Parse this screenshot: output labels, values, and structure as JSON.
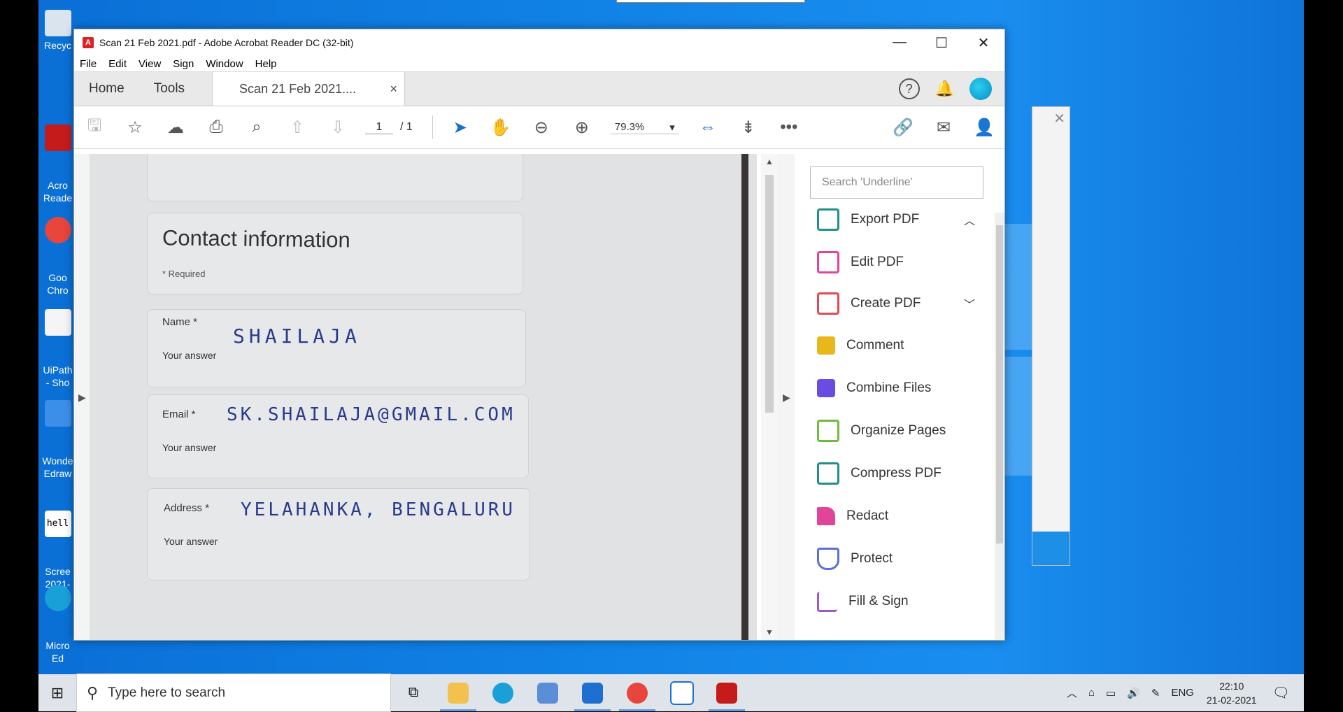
{
  "desktop": {
    "icons": [
      {
        "label": "Recyc",
        "color": "#d9e4ee"
      },
      {
        "label": "Acro\nReade",
        "color": "#c61b1b"
      },
      {
        "label": "Goo\nChro",
        "color": "#e8453c"
      },
      {
        "label": "UiPath\n- Sho",
        "color": "#f5f5f5"
      },
      {
        "label": "Wonde\nEdraw",
        "color": "#3b8fe8"
      },
      {
        "label": "Scree\n2021-",
        "color": "#ffffff"
      },
      {
        "label": "Micro\nEd",
        "color": "#1aa0d8"
      }
    ],
    "screen_text_icon": "hell"
  },
  "window": {
    "title": "Scan 21 Feb 2021.pdf - Adobe Acrobat Reader DC (32-bit)",
    "min": "—",
    "max": "☐",
    "close": "✕"
  },
  "menu": [
    "File",
    "Edit",
    "View",
    "Sign",
    "Window",
    "Help"
  ],
  "tabs": {
    "home": "Home",
    "tools": "Tools",
    "doc": "Scan 21 Feb 2021....",
    "doc_close": "×",
    "help": "?"
  },
  "toolbar": {
    "page_current": "1",
    "page_total": "/ 1",
    "zoom": "79.3%"
  },
  "form": {
    "heading": "Contact information",
    "required": "* Required",
    "name_label": "Name *",
    "name_answer_label": "Your answer",
    "name_value": "SHAILAJA",
    "email_label": "Email *",
    "email_answer_label": "Your answer",
    "email_value": "SK.SHAILAJA@GMAIL.COM",
    "address_label": "Address *",
    "address_answer_label": "Your answer",
    "address_value": "YELAHANKA, BENGALURU"
  },
  "panel": {
    "search_placeholder": "Search 'Underline'",
    "tools": [
      {
        "label": "Export PDF",
        "color": "#1f8f8c",
        "chevron": "︿"
      },
      {
        "label": "Edit PDF",
        "color": "#e0459a",
        "chevron": ""
      },
      {
        "label": "Create PDF",
        "color": "#e34850",
        "chevron": "﹀"
      },
      {
        "label": "Comment",
        "color": "#e8b81a",
        "chevron": ""
      },
      {
        "label": "Combine Files",
        "color": "#6a4ce0",
        "chevron": ""
      },
      {
        "label": "Organize Pages",
        "color": "#6fb93c",
        "chevron": ""
      },
      {
        "label": "Compress PDF",
        "color": "#1f8f8c",
        "chevron": ""
      },
      {
        "label": "Redact",
        "color": "#e0459a",
        "chevron": ""
      },
      {
        "label": "Protect",
        "color": "#5b6fd8",
        "chevron": ""
      },
      {
        "label": "Fill & Sign",
        "color": "#9b59d0",
        "chevron": ""
      }
    ]
  },
  "taskbar": {
    "search_placeholder": "Type here to search",
    "lang": "ENG",
    "time": "22:10",
    "date": "21-02-2021"
  }
}
